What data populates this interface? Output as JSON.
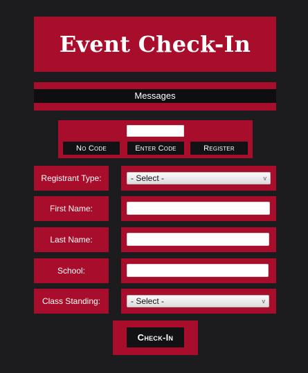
{
  "title": "Event Check-In",
  "messages_label": "Messages",
  "code_entry": {
    "value": "",
    "buttons": {
      "no_code": "No Code",
      "enter_code": "Enter Code",
      "register": "Register"
    }
  },
  "form": {
    "registrant_type": {
      "label": "Registrant Type:",
      "value": "- Select -"
    },
    "first_name": {
      "label": "First Name:",
      "value": ""
    },
    "last_name": {
      "label": "Last Name:",
      "value": ""
    },
    "school": {
      "label": "School:",
      "value": ""
    },
    "class_standing": {
      "label": "Class Standing:",
      "value": "- Select -"
    }
  },
  "check_in_label": "Check-In",
  "dropdown_glyph": "v",
  "colors": {
    "accent": "#a80d2b",
    "background": "#1c1b1d",
    "button": "#121214"
  }
}
